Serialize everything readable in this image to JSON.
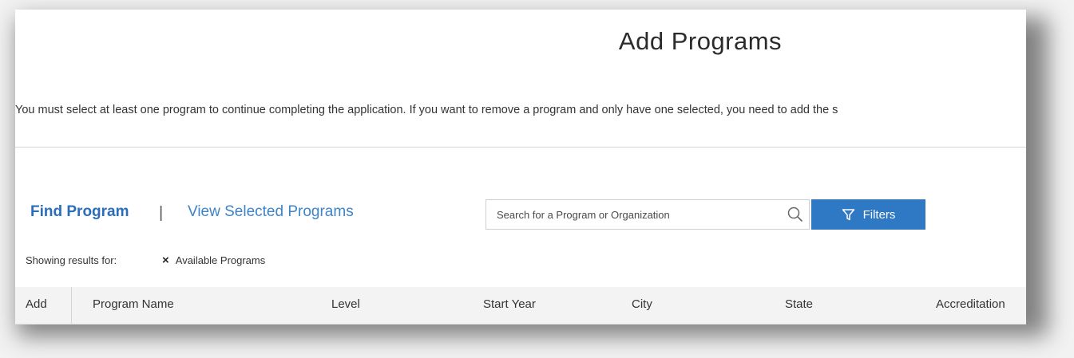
{
  "page": {
    "title": "Add Programs",
    "instruction": "You must select at least one program to continue completing the application. If you want to remove a program and only have one selected, you need to add the s"
  },
  "tabs": {
    "find_program": "Find Program",
    "separator": "|",
    "view_selected": "View Selected Programs"
  },
  "search": {
    "placeholder": "Search for a Program or Organization",
    "value": ""
  },
  "filters_button": {
    "label": "Filters",
    "color": "#2e78c4"
  },
  "results": {
    "showing_label": "Showing results for:",
    "active_filter": "Available Programs",
    "remove_glyph": "×"
  },
  "table": {
    "columns": [
      "Add",
      "Program Name",
      "Level",
      "Start Year",
      "City",
      "State",
      "Accreditation"
    ]
  },
  "icons": {
    "search": "search-icon",
    "filter": "filter-icon",
    "remove": "close-icon"
  },
  "colors": {
    "accent": "#2a6ebb",
    "link": "#3d84c9",
    "header_bg": "#f3f3f3"
  }
}
